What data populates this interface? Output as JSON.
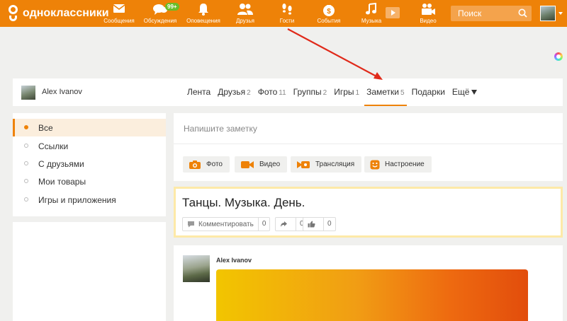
{
  "brand": {
    "logo_text": "одноклассники",
    "accent": "#ee8208",
    "highlight": "#fde9a8"
  },
  "topnav": {
    "items": [
      {
        "label": "Сообщения",
        "icon": "envelope-icon"
      },
      {
        "label": "Обсуждения",
        "icon": "speech-bubbles-icon",
        "badge": "99+"
      },
      {
        "label": "Оповещения",
        "icon": "bell-icon"
      },
      {
        "label": "Друзья",
        "icon": "people-icon"
      },
      {
        "label": "Гости",
        "icon": "footprints-icon"
      },
      {
        "label": "События",
        "icon": "money-bag-icon"
      },
      {
        "label": "Музыка",
        "icon": "music-note-icon"
      },
      {
        "label": "",
        "icon": "video-play-icon"
      },
      {
        "label": "Видео",
        "icon": "movie-camera-icon"
      }
    ],
    "search_placeholder": "Поиск"
  },
  "profile": {
    "name": "Alex Ivanov",
    "tabs": [
      {
        "label": "Лента",
        "count": ""
      },
      {
        "label": "Друзья",
        "count": "2"
      },
      {
        "label": "Фото",
        "count": "11"
      },
      {
        "label": "Группы",
        "count": "2"
      },
      {
        "label": "Игры",
        "count": "1"
      },
      {
        "label": "Заметки",
        "count": "5"
      },
      {
        "label": "Подарки",
        "count": ""
      },
      {
        "label": "Ещё",
        "count": ""
      }
    ]
  },
  "left_menu": {
    "items": [
      {
        "label": "Все"
      },
      {
        "label": "Ссылки"
      },
      {
        "label": "С друзьями"
      },
      {
        "label": "Мои товары"
      },
      {
        "label": "Игры и приложения"
      }
    ]
  },
  "composer": {
    "placeholder": "Напишите заметку",
    "buttons": [
      {
        "label": "Фото",
        "icon": "camera-icon"
      },
      {
        "label": "Видео",
        "icon": "video-camera-icon"
      },
      {
        "label": "Трансляция",
        "icon": "broadcast-icon"
      },
      {
        "label": "Настроение",
        "icon": "smiley-icon"
      }
    ]
  },
  "note": {
    "title": "Танцы. Музыка. День.",
    "comment_label": "Комментировать",
    "comment_count": "0",
    "share_count": "0",
    "like_count": "0"
  },
  "post": {
    "author": "Alex Ivanov"
  }
}
